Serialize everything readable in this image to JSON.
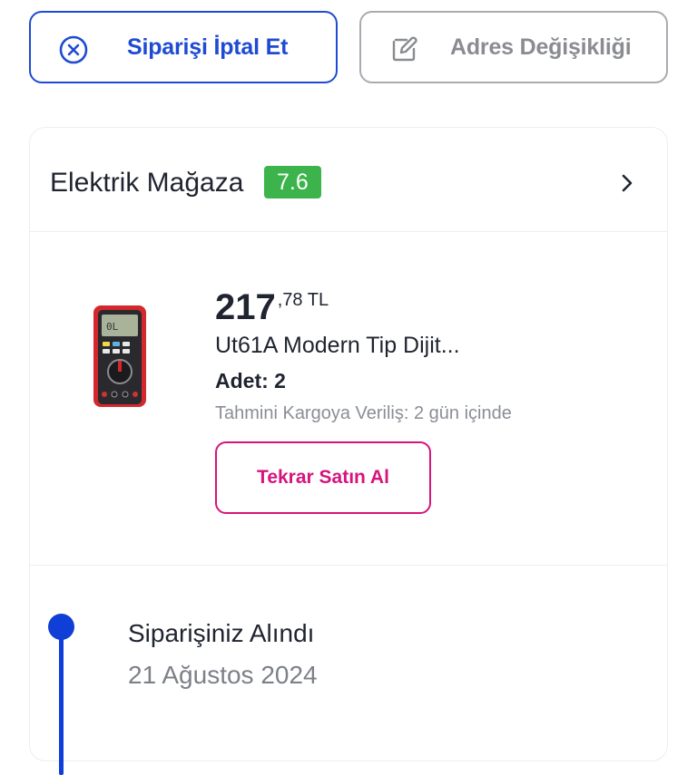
{
  "actions": {
    "cancel_label": "Siparişi İptal Et",
    "cancel_icon": "close-circle-icon",
    "address_label": "Adres Değişikliği",
    "address_icon": "edit-pencil-icon"
  },
  "store": {
    "name": "Elektrik Mağaza",
    "rating": "7.6",
    "rating_color": "#3cb44b"
  },
  "product": {
    "price_int": "217",
    "price_dec": ",78 TL",
    "name": "Ut61A Modern Tip Dijit...",
    "quantity": "Adet: 2",
    "shipping": "Tahmini Kargoya Veriliş: 2 gün içinde",
    "rebuy_label": "Tekrar Satın Al"
  },
  "timeline": {
    "title": "Siparişiniz Alındı",
    "date": "21 Ağustos 2024"
  },
  "colors": {
    "primary": "#1e4bd2",
    "accent_pink": "#d6147d",
    "muted_border": "#a9abb0"
  }
}
